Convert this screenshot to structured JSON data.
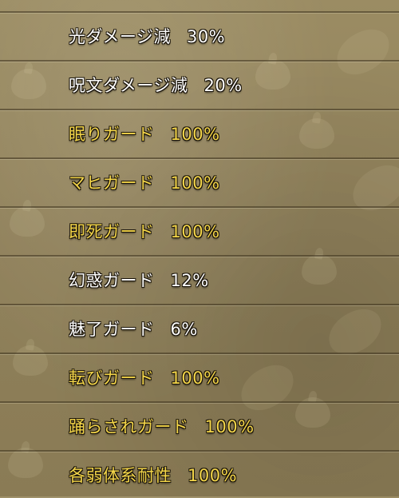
{
  "rows": [
    {
      "name": "光ダメージ減",
      "value": "30%",
      "color": "#ffffff"
    },
    {
      "name": "呪文ダメージ減",
      "value": "20%",
      "color": "#ffffff"
    },
    {
      "name": "眠りガード",
      "value": "100%",
      "color": "#f4d64a"
    },
    {
      "name": "マヒガード",
      "value": "100%",
      "color": "#f4d64a"
    },
    {
      "name": "即死ガード",
      "value": "100%",
      "color": "#f4d64a"
    },
    {
      "name": "幻惑ガード",
      "value": "12%",
      "color": "#ffffff"
    },
    {
      "name": "魅了ガード",
      "value": "6%",
      "color": "#ffffff"
    },
    {
      "name": "転びガード",
      "value": "100%",
      "color": "#f4d64a"
    },
    {
      "name": "踊らされガード",
      "value": "100%",
      "color": "#f4d64a"
    },
    {
      "name": "各弱体系耐性",
      "value": "100%",
      "color": "#f4d64a"
    }
  ]
}
